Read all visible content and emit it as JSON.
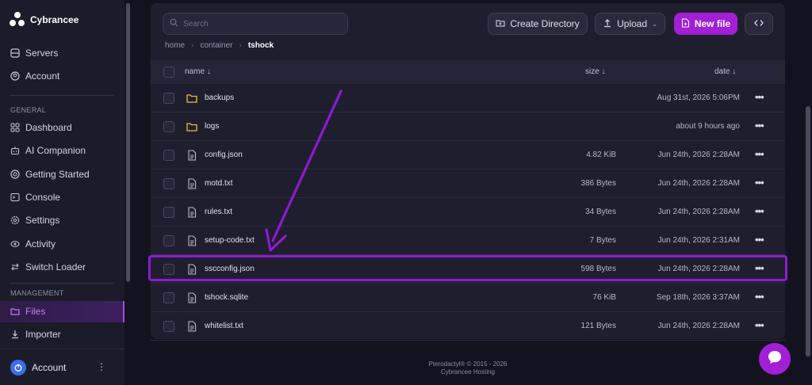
{
  "brand": {
    "name": "Cybrancee"
  },
  "sidebar": {
    "top_items": [
      {
        "label": "Servers",
        "icon": "server-icon"
      },
      {
        "label": "Account",
        "icon": "account-icon"
      }
    ],
    "general_title": "GENERAL",
    "general_items": [
      {
        "label": "Dashboard",
        "icon": "dashboard-icon"
      },
      {
        "label": "AI Companion",
        "icon": "robot-icon"
      },
      {
        "label": "Getting Started",
        "icon": "help-icon"
      },
      {
        "label": "Console",
        "icon": "terminal-icon"
      },
      {
        "label": "Settings",
        "icon": "gear-icon"
      },
      {
        "label": "Activity",
        "icon": "eye-icon"
      },
      {
        "label": "Switch Loader",
        "icon": "switch-icon"
      }
    ],
    "management_title": "MANAGEMENT",
    "management_items": [
      {
        "label": "Files",
        "icon": "folder-icon",
        "active": true
      },
      {
        "label": "Importer",
        "icon": "download-icon"
      }
    ],
    "footer": {
      "label": "Account"
    }
  },
  "toolbar": {
    "search_placeholder": "Search",
    "create_directory_label": "Create Directory",
    "upload_label": "Upload",
    "new_file_label": "New file",
    "accent_color": "#a21fd6"
  },
  "breadcrumb": [
    "home",
    "container",
    "tshock"
  ],
  "table": {
    "headers": {
      "name": "name ↓",
      "size": "size ↓",
      "date": "date ↓"
    },
    "rows": [
      {
        "name": "backups",
        "type": "folder",
        "size": "",
        "date": "Aug 31st, 2026 5:06PM"
      },
      {
        "name": "logs",
        "type": "folder",
        "size": "",
        "date": "about 9 hours ago"
      },
      {
        "name": "config.json",
        "type": "file",
        "size": "4.82 KiB",
        "date": "Jun 24th, 2026 2:28AM"
      },
      {
        "name": "motd.txt",
        "type": "file",
        "size": "386 Bytes",
        "date": "Jun 24th, 2026 2:28AM"
      },
      {
        "name": "rules.txt",
        "type": "file",
        "size": "34 Bytes",
        "date": "Jun 24th, 2026 2:28AM"
      },
      {
        "name": "setup-code.txt",
        "type": "file",
        "size": "7 Bytes",
        "date": "Jun 24th, 2026 2:31AM"
      },
      {
        "name": "sscconfig.json",
        "type": "file",
        "size": "598 Bytes",
        "date": "Jun 24th, 2026 2:28AM",
        "highlighted": true
      },
      {
        "name": "tshock.sqlite",
        "type": "file",
        "size": "76 KiB",
        "date": "Sep 18th, 2026 3:37AM"
      },
      {
        "name": "whitelist.txt",
        "type": "file",
        "size": "121 Bytes",
        "date": "Jun 24th, 2026 2:28AM"
      }
    ]
  },
  "footer": {
    "line1": "Pterodactyl® © 2015 - 2026",
    "line2": "Cybrancee Hosting"
  }
}
